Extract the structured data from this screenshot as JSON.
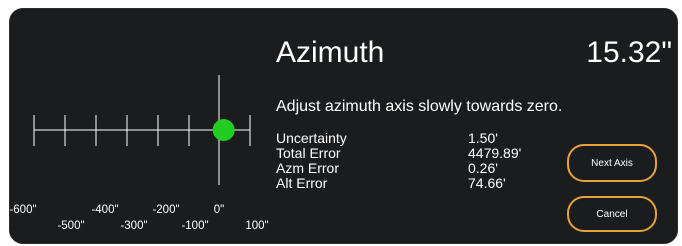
{
  "dialog": {
    "title": "Azimuth",
    "value": "15.32\"",
    "instruction": "Adjust azimuth axis slowly towards zero."
  },
  "stats": [
    {
      "label": "Uncertainty",
      "value": "1.50'"
    },
    {
      "label": "Total Error",
      "value": "4479.89'"
    },
    {
      "label": "Azm Error",
      "value": "0.26'"
    },
    {
      "label": "Alt Error",
      "value": "74.66'"
    }
  ],
  "buttons": {
    "next_label": "Next Axis",
    "cancel_label": "Cancel"
  },
  "gauge": {
    "ticks_upper": [
      "-600\"",
      "-400\"",
      "-200\"",
      "0\""
    ],
    "ticks_lower": [
      "-500\"",
      "-300\"",
      "-100\"",
      "100\""
    ],
    "indicator_value": 15.32,
    "indicator_color": "#22cc22",
    "accent_color": "#e8a13a"
  }
}
